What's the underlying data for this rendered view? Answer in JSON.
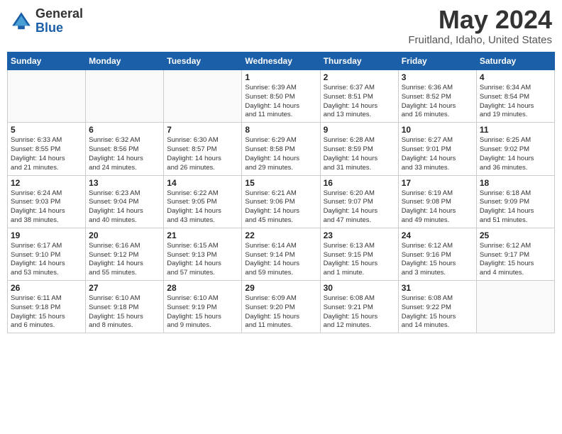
{
  "header": {
    "logo_general": "General",
    "logo_blue": "Blue",
    "title": "May 2024",
    "location": "Fruitland, Idaho, United States"
  },
  "days_of_week": [
    "Sunday",
    "Monday",
    "Tuesday",
    "Wednesday",
    "Thursday",
    "Friday",
    "Saturday"
  ],
  "weeks": [
    [
      {
        "day": "",
        "info": ""
      },
      {
        "day": "",
        "info": ""
      },
      {
        "day": "",
        "info": ""
      },
      {
        "day": "1",
        "info": "Sunrise: 6:39 AM\nSunset: 8:50 PM\nDaylight: 14 hours\nand 11 minutes."
      },
      {
        "day": "2",
        "info": "Sunrise: 6:37 AM\nSunset: 8:51 PM\nDaylight: 14 hours\nand 13 minutes."
      },
      {
        "day": "3",
        "info": "Sunrise: 6:36 AM\nSunset: 8:52 PM\nDaylight: 14 hours\nand 16 minutes."
      },
      {
        "day": "4",
        "info": "Sunrise: 6:34 AM\nSunset: 8:54 PM\nDaylight: 14 hours\nand 19 minutes."
      }
    ],
    [
      {
        "day": "5",
        "info": "Sunrise: 6:33 AM\nSunset: 8:55 PM\nDaylight: 14 hours\nand 21 minutes."
      },
      {
        "day": "6",
        "info": "Sunrise: 6:32 AM\nSunset: 8:56 PM\nDaylight: 14 hours\nand 24 minutes."
      },
      {
        "day": "7",
        "info": "Sunrise: 6:30 AM\nSunset: 8:57 PM\nDaylight: 14 hours\nand 26 minutes."
      },
      {
        "day": "8",
        "info": "Sunrise: 6:29 AM\nSunset: 8:58 PM\nDaylight: 14 hours\nand 29 minutes."
      },
      {
        "day": "9",
        "info": "Sunrise: 6:28 AM\nSunset: 8:59 PM\nDaylight: 14 hours\nand 31 minutes."
      },
      {
        "day": "10",
        "info": "Sunrise: 6:27 AM\nSunset: 9:01 PM\nDaylight: 14 hours\nand 33 minutes."
      },
      {
        "day": "11",
        "info": "Sunrise: 6:25 AM\nSunset: 9:02 PM\nDaylight: 14 hours\nand 36 minutes."
      }
    ],
    [
      {
        "day": "12",
        "info": "Sunrise: 6:24 AM\nSunset: 9:03 PM\nDaylight: 14 hours\nand 38 minutes."
      },
      {
        "day": "13",
        "info": "Sunrise: 6:23 AM\nSunset: 9:04 PM\nDaylight: 14 hours\nand 40 minutes."
      },
      {
        "day": "14",
        "info": "Sunrise: 6:22 AM\nSunset: 9:05 PM\nDaylight: 14 hours\nand 43 minutes."
      },
      {
        "day": "15",
        "info": "Sunrise: 6:21 AM\nSunset: 9:06 PM\nDaylight: 14 hours\nand 45 minutes."
      },
      {
        "day": "16",
        "info": "Sunrise: 6:20 AM\nSunset: 9:07 PM\nDaylight: 14 hours\nand 47 minutes."
      },
      {
        "day": "17",
        "info": "Sunrise: 6:19 AM\nSunset: 9:08 PM\nDaylight: 14 hours\nand 49 minutes."
      },
      {
        "day": "18",
        "info": "Sunrise: 6:18 AM\nSunset: 9:09 PM\nDaylight: 14 hours\nand 51 minutes."
      }
    ],
    [
      {
        "day": "19",
        "info": "Sunrise: 6:17 AM\nSunset: 9:10 PM\nDaylight: 14 hours\nand 53 minutes."
      },
      {
        "day": "20",
        "info": "Sunrise: 6:16 AM\nSunset: 9:12 PM\nDaylight: 14 hours\nand 55 minutes."
      },
      {
        "day": "21",
        "info": "Sunrise: 6:15 AM\nSunset: 9:13 PM\nDaylight: 14 hours\nand 57 minutes."
      },
      {
        "day": "22",
        "info": "Sunrise: 6:14 AM\nSunset: 9:14 PM\nDaylight: 14 hours\nand 59 minutes."
      },
      {
        "day": "23",
        "info": "Sunrise: 6:13 AM\nSunset: 9:15 PM\nDaylight: 15 hours\nand 1 minute."
      },
      {
        "day": "24",
        "info": "Sunrise: 6:12 AM\nSunset: 9:16 PM\nDaylight: 15 hours\nand 3 minutes."
      },
      {
        "day": "25",
        "info": "Sunrise: 6:12 AM\nSunset: 9:17 PM\nDaylight: 15 hours\nand 4 minutes."
      }
    ],
    [
      {
        "day": "26",
        "info": "Sunrise: 6:11 AM\nSunset: 9:18 PM\nDaylight: 15 hours\nand 6 minutes."
      },
      {
        "day": "27",
        "info": "Sunrise: 6:10 AM\nSunset: 9:18 PM\nDaylight: 15 hours\nand 8 minutes."
      },
      {
        "day": "28",
        "info": "Sunrise: 6:10 AM\nSunset: 9:19 PM\nDaylight: 15 hours\nand 9 minutes."
      },
      {
        "day": "29",
        "info": "Sunrise: 6:09 AM\nSunset: 9:20 PM\nDaylight: 15 hours\nand 11 minutes."
      },
      {
        "day": "30",
        "info": "Sunrise: 6:08 AM\nSunset: 9:21 PM\nDaylight: 15 hours\nand 12 minutes."
      },
      {
        "day": "31",
        "info": "Sunrise: 6:08 AM\nSunset: 9:22 PM\nDaylight: 15 hours\nand 14 minutes."
      },
      {
        "day": "",
        "info": ""
      }
    ]
  ]
}
